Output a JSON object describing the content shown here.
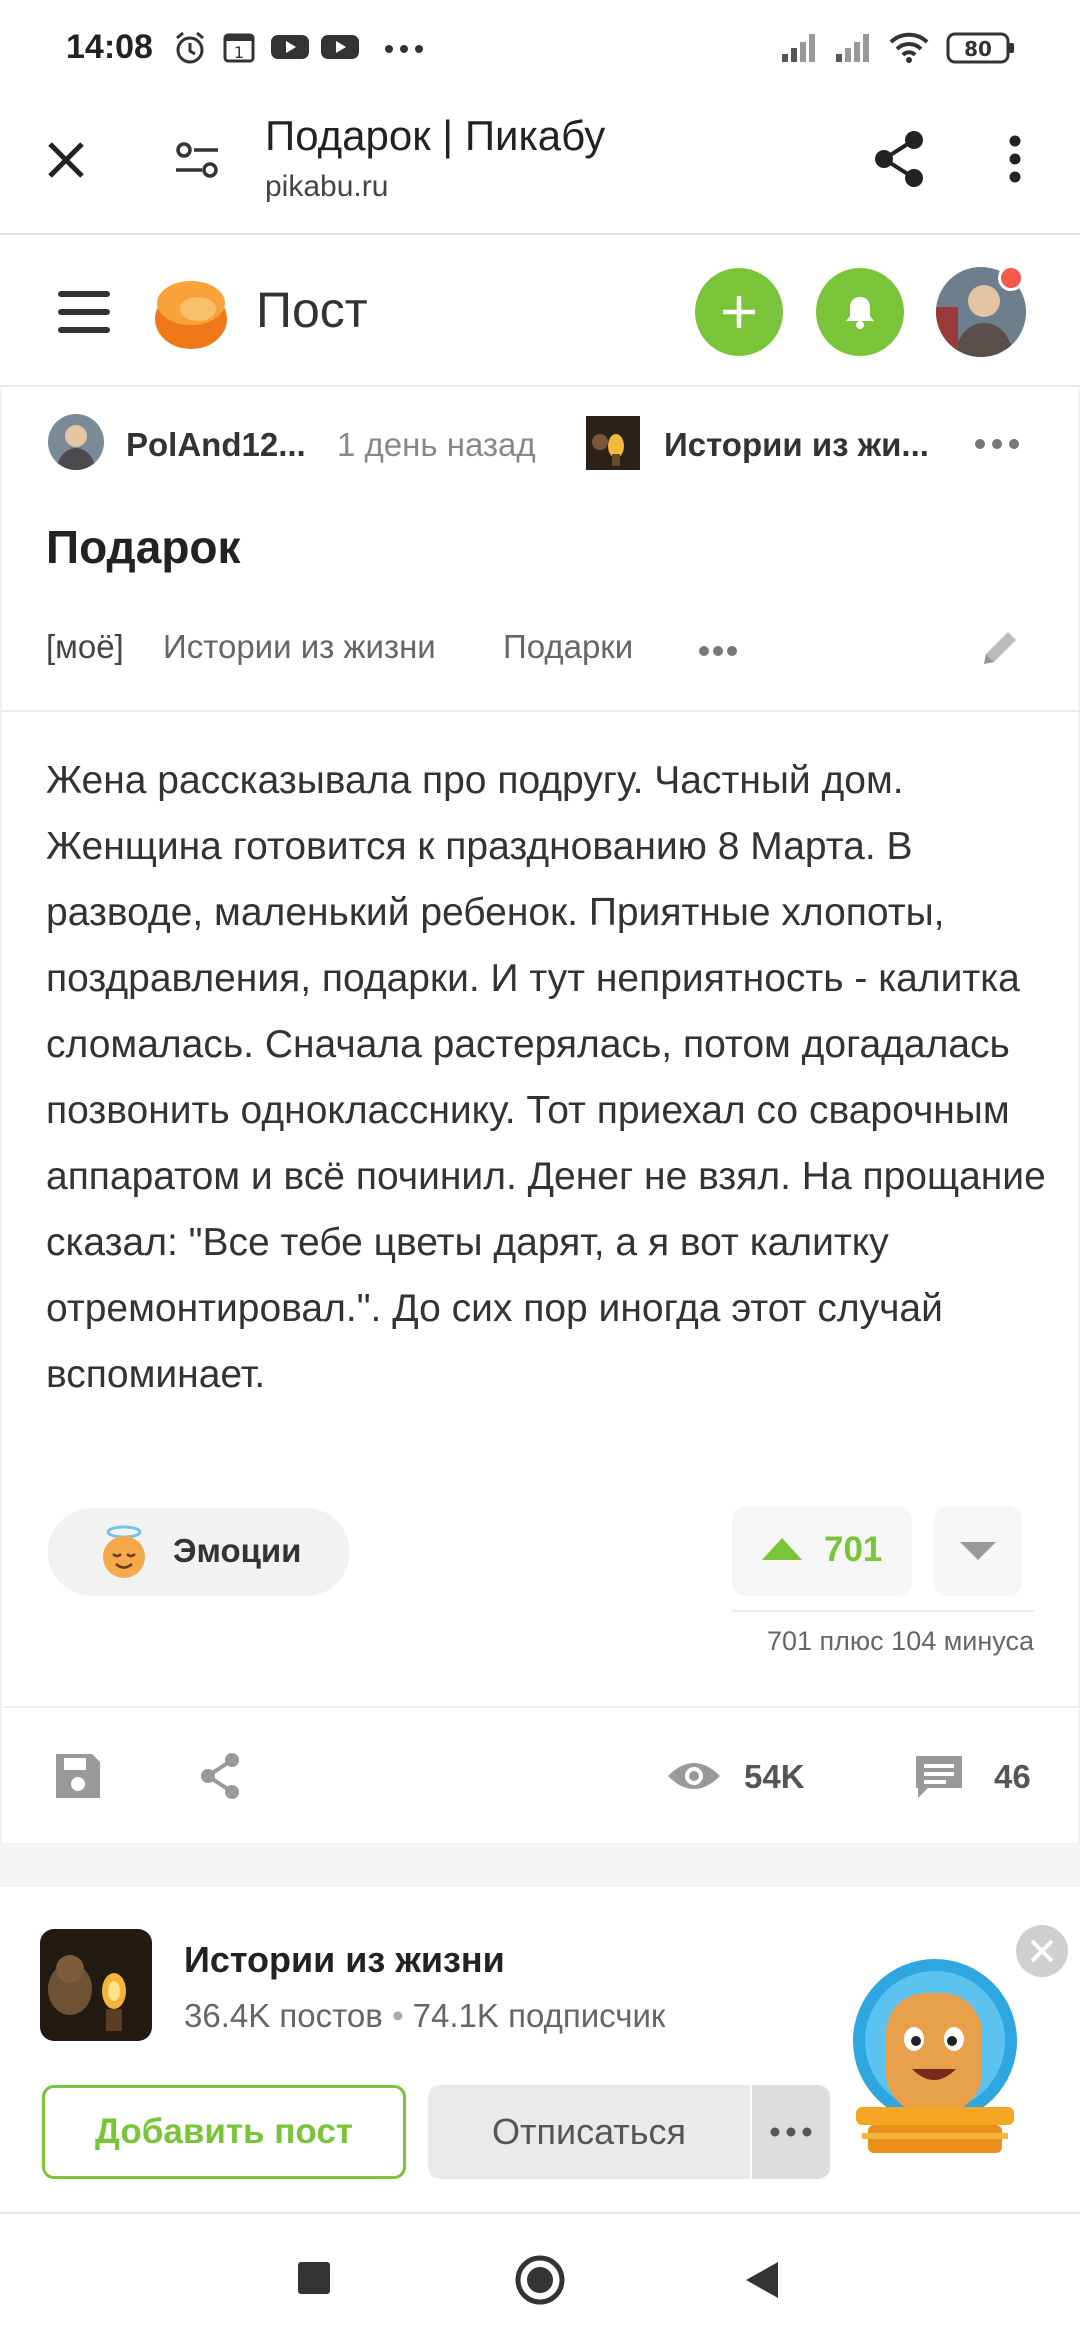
{
  "status_bar": {
    "time": "14:08",
    "battery": "80",
    "icons": [
      "alarm-icon",
      "calendar-icon",
      "youtube-icon",
      "youtube-icon",
      "more-dots-icon",
      "signal-icon",
      "signal-icon",
      "wifi-icon",
      "battery-icon"
    ]
  },
  "browser": {
    "title": "Подарок | Пикабу",
    "domain": "pikabu.ru",
    "icons": [
      "close-icon",
      "site-settings-icon",
      "share-icon",
      "menu-dots-icon"
    ]
  },
  "header": {
    "section": "Пост",
    "accent_color": "#7ac43a",
    "icons": [
      "hamburger-icon",
      "pikabu-logo-icon",
      "plus-icon",
      "bell-icon",
      "avatar"
    ]
  },
  "post": {
    "author": "PolAnd12...",
    "time_ago": "1 день назад",
    "community": "Истории из жи...",
    "title": "Подарок",
    "tags": [
      "[моё]",
      "Истории из жизни",
      "Подарки"
    ],
    "body": "Жена рассказывала про подругу. Частный дом. Женщина готовится к празднованию 8 Марта. В разводе, маленький ребенок. Приятные хлопоты, поздравления, подарки. И тут неприятность - калитка сломалась. Сначала растерялась, потом догадалась позвонить однокласснику. Тот приехал со сварочным аппаратом и всё починил. Денег не взял. На прощание сказал: \"Все тебе цветы дарят, а я вот калитку отремонтировал.\". До сих пор иногда этот случай вспоминает.",
    "emotions_label": "Эмоции",
    "rating": "701",
    "rating_summary": "701 плюс 104 минуса",
    "views": "54K",
    "comments": "46"
  },
  "community": {
    "name": "Истории из жизни",
    "posts": "36.4K постов",
    "separator": "•",
    "subscribers": "74.1K подписчик",
    "add_post_label": "Добавить пост",
    "unsubscribe_label": "Отписаться"
  },
  "navbar": {
    "icons": [
      "recents-icon",
      "home-icon",
      "back-icon"
    ]
  }
}
